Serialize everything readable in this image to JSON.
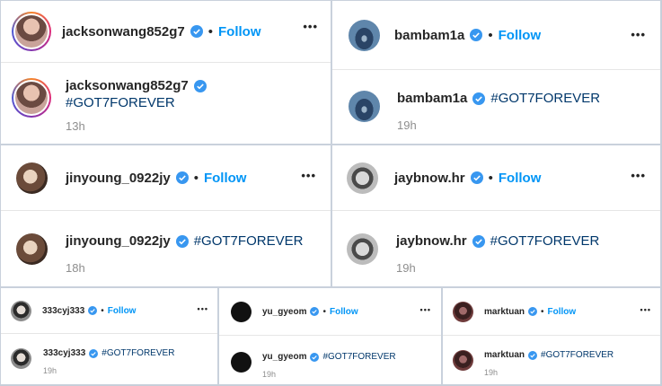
{
  "posts": [
    {
      "username": "jacksonwang852g7",
      "dot": "•",
      "follow": "Follow",
      "more": "•••",
      "hashtag": "#GOT7FOREVER",
      "time": "13h"
    },
    {
      "username": "bambam1a",
      "dot": "•",
      "follow": "Follow",
      "more": "•••",
      "hashtag": "#GOT7FOREVER",
      "time": "19h"
    },
    {
      "username": "jinyoung_0922jy",
      "dot": "•",
      "follow": "Follow",
      "more": "•••",
      "hashtag": "#GOT7FOREVER",
      "time": "18h"
    },
    {
      "username": "jaybnow.hr",
      "dot": "•",
      "follow": "Follow",
      "more": "•••",
      "hashtag": "#GOT7FOREVER",
      "time": "19h"
    },
    {
      "username": "333cyj333",
      "dot": "•",
      "follow": "Follow",
      "more": "•••",
      "hashtag": "#GOT7FOREVER",
      "time": "19h"
    },
    {
      "username": "yu_gyeom",
      "dot": "•",
      "follow": "Follow",
      "more": "•••",
      "hashtag": "#GOT7FOREVER",
      "time": "19h"
    },
    {
      "username": "marktuan",
      "dot": "•",
      "follow": "Follow",
      "more": "•••",
      "hashtag": "#GOT7FOREVER",
      "time": "19h"
    }
  ],
  "colors": {
    "follow": "#0095f6",
    "verified": "#3897f0",
    "hashtag": "#00376b",
    "muted": "#8e8e8e"
  },
  "icons": {
    "verified": "verified-badge-icon",
    "more": "more-options-icon"
  }
}
